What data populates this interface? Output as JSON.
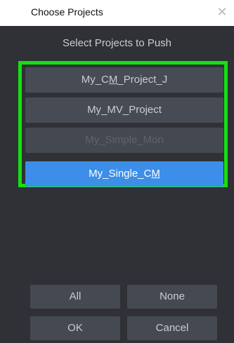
{
  "window": {
    "title": "Choose Projects",
    "close_glyph": "✕"
  },
  "dialog": {
    "heading": "Select Projects to Push",
    "highlight_color": "#15e010",
    "projects": [
      {
        "label_pre": "My_C",
        "label_ul": "M",
        "label_post": "_Project_J",
        "state": "normal"
      },
      {
        "label_pre": "My_MV_Project",
        "label_ul": "",
        "label_post": "",
        "state": "normal"
      },
      {
        "label_pre": "My_Simple_Mon",
        "label_ul": "",
        "label_post": "",
        "state": "disabled"
      },
      {
        "label_pre": "My_Single_C",
        "label_ul": "M",
        "label_post": "",
        "state": "selected"
      }
    ],
    "buttons": {
      "all": "All",
      "none": "None",
      "ok": "OK",
      "cancel": "Cancel"
    },
    "colors": {
      "background": "#2f3137",
      "button": "#474b54",
      "selected": "#3d8ee8"
    }
  }
}
